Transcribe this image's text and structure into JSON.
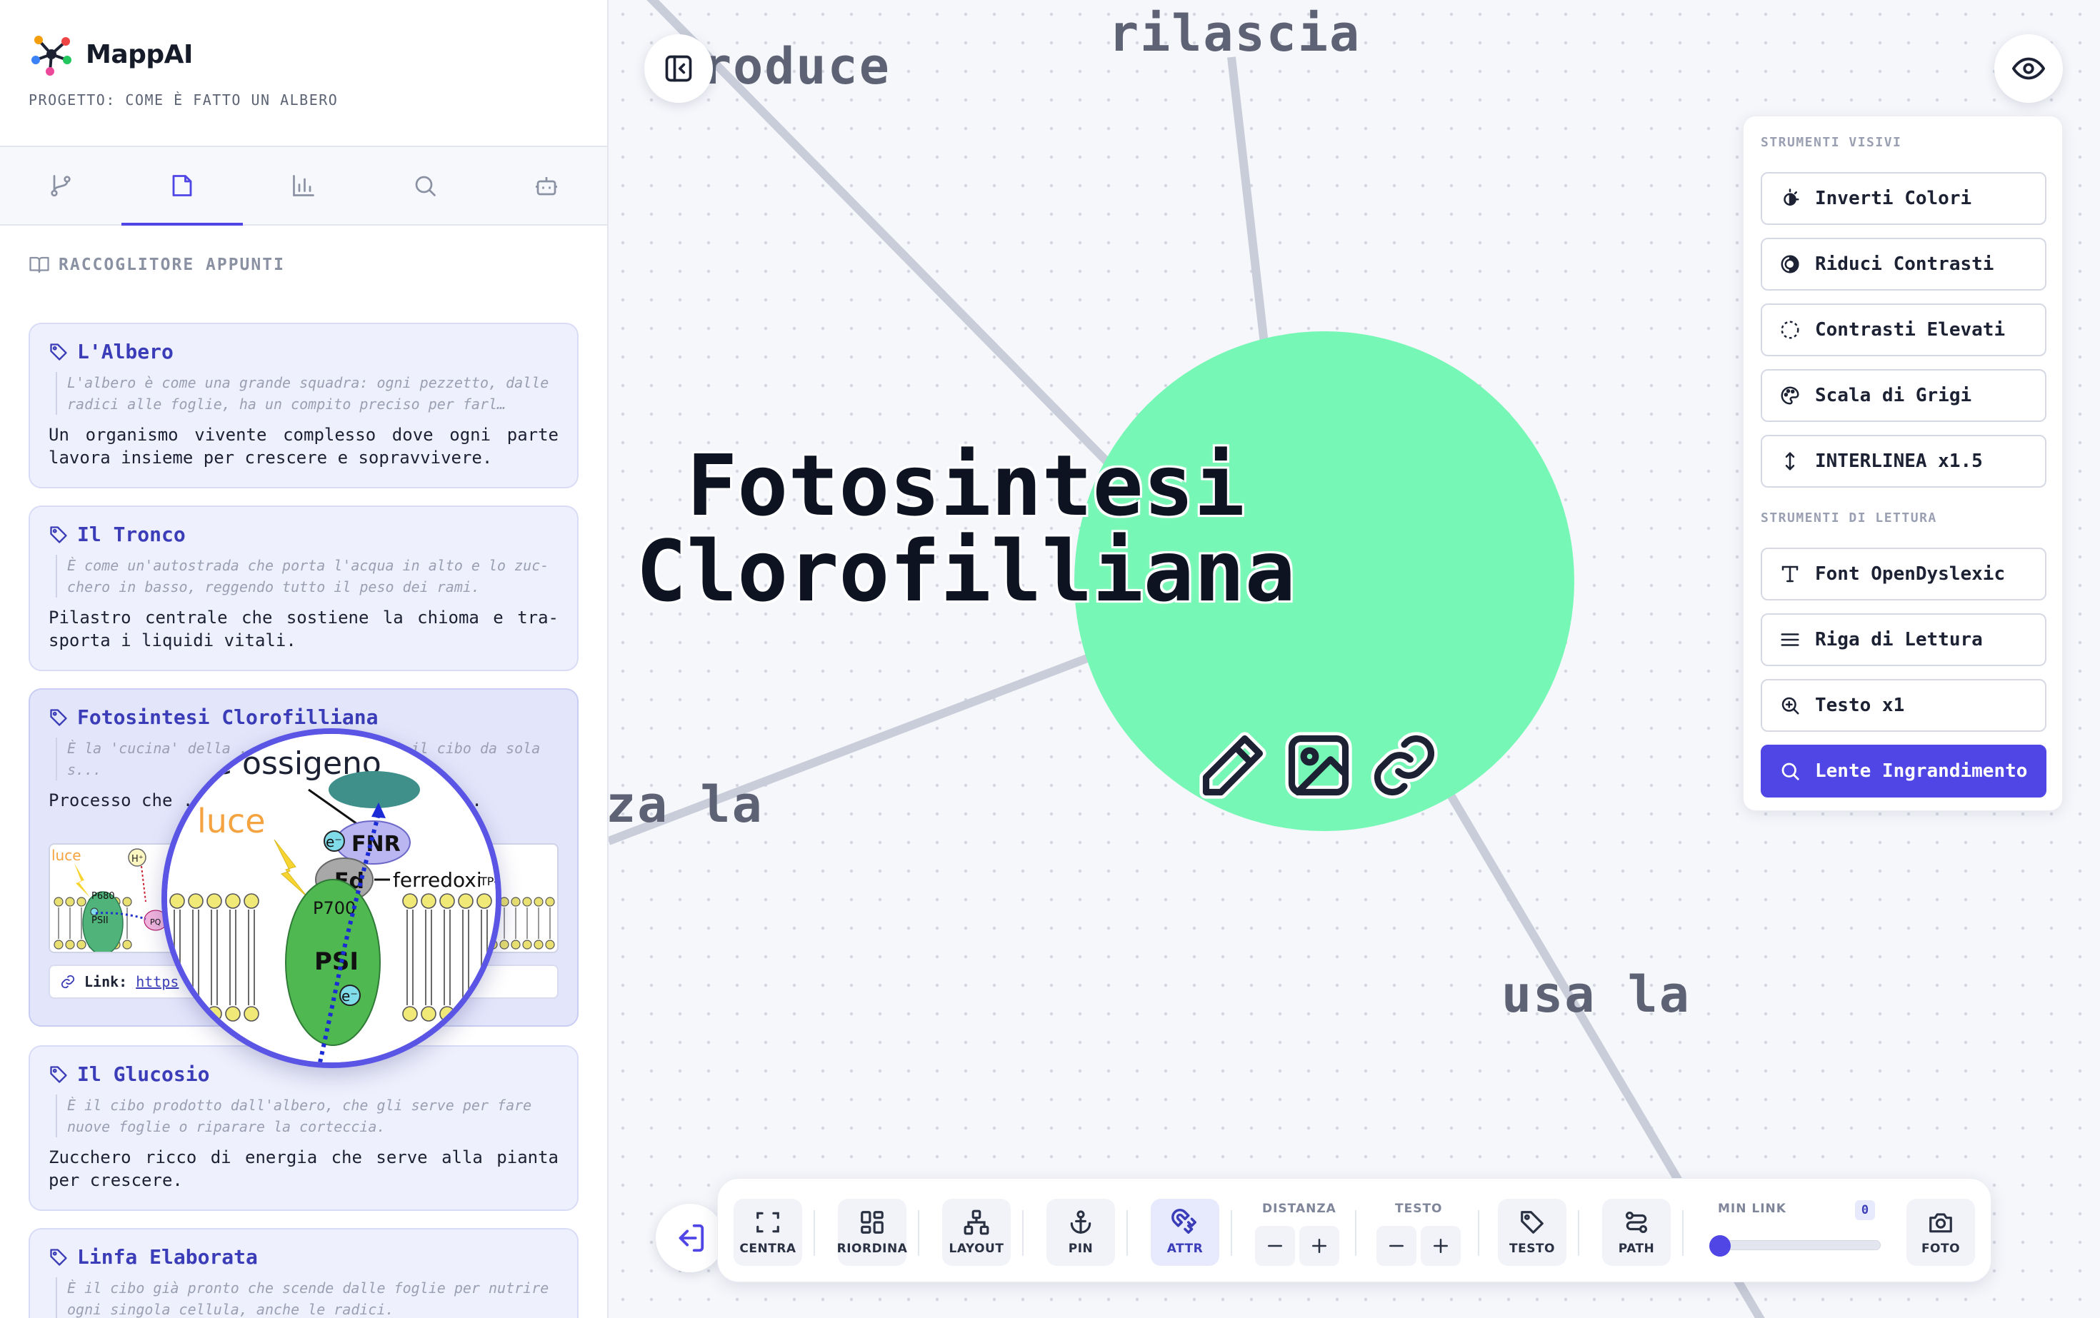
{
  "app": {
    "name": "MappAI",
    "project": "PROGETTO: COME È FATTO UN ALBERO"
  },
  "sidebar": {
    "tabs": [
      {
        "icon": "git-branch-icon"
      },
      {
        "icon": "note-icon",
        "active": true
      },
      {
        "icon": "bar-chart-icon"
      },
      {
        "icon": "search-icon"
      },
      {
        "icon": "bot-icon"
      }
    ],
    "section_title": "RACCOGLITORE APPUNTI",
    "notes": [
      {
        "title": "L'Albero",
        "quote": "L'albero è come una grande squadra: ogni pezzetto, dalle radici alle foglie, ha un compito preciso per farl…",
        "body": "Un organismo vivente complesso dove ogni parte lavora insieme per crescere e sopravvivere."
      },
      {
        "title": "Il Tronco",
        "quote": "È come un'autostrada che porta l'acqua in alto e lo zuc­chero in basso, reggendo tutto il peso dei rami.",
        "body": "Pilastro centrale che sostiene la chioma e tra­sporta i liquidi vitali."
      },
      {
        "title": "Fotosintesi Clorofilliana",
        "quote": "È la 'cucina' della ... per fabbricarsi il cibo da sola s...",
        "body": "Processo che ... anidride carbonica in ...",
        "link_label": "Link:",
        "link_url": "https",
        "image_labels": {
          "luce": "luce",
          "h": "H⁺",
          "p680": "P680",
          "psii": "PSII",
          "pq": "PQ"
        },
        "magnifier": {
          "ossigeno": "e ossigeno",
          "luce": "luce",
          "fnr": "FNR",
          "fd": "Fd",
          "ferredoxina": "ferredoxi",
          "atp": "TP-sintetasi",
          "p700": "P700",
          "psi": "PSI",
          "e": "e⁻"
        }
      },
      {
        "title": "Il Glucosio",
        "quote": "È il cibo prodotto dall'albero, che gli serve per fare nuove foglie o riparare la corteccia.",
        "body": "Zucchero ricco di energia che serve alla pianta per crescere."
      },
      {
        "title": "Linfa Elaborata",
        "quote": "È il cibo già pronto che scende dalle foglie per nutrire ogni singola cellula, anche le radici.",
        "body": ""
      }
    ]
  },
  "canvas": {
    "edge_labels": [
      "roduce",
      "rilascia",
      "za la",
      "usa la"
    ],
    "node": {
      "title_line1": "Fotosintesi",
      "title_line2": "Clorofilliana",
      "color": "#77f7b5"
    },
    "node_tools": [
      "pencil-icon",
      "image-icon",
      "link-icon"
    ]
  },
  "accessibility": {
    "visual_group": "STRUMENTI VISIVI",
    "visual_tools": [
      {
        "label": "Inverti Colori",
        "icon": "invert-icon"
      },
      {
        "label": "Riduci Contrasti",
        "icon": "contrast-icon"
      },
      {
        "label": "Contrasti Elevati",
        "icon": "dashed-circle-icon"
      },
      {
        "label": "Scala di Grigi",
        "icon": "palette-icon"
      },
      {
        "label": "INTERLINEA x1.5",
        "icon": "line-height-icon"
      }
    ],
    "reading_group": "STRUMENTI DI LETTURA",
    "reading_tools": [
      {
        "label": "Font OpenDyslexic",
        "icon": "type-icon"
      },
      {
        "label": "Riga di Lettura",
        "icon": "lines-icon"
      },
      {
        "label": "Testo x1",
        "icon": "zoom-in-icon"
      },
      {
        "label": "Lente Ingrandimento",
        "icon": "search-icon",
        "active": true
      }
    ]
  },
  "toolbar": {
    "centra": "CENTRA",
    "riordina": "RIORDINA",
    "layout": "LAYOUT",
    "pin": "PIN",
    "attr": "ATTR",
    "distanza": "DISTANZA",
    "testo_group": "TESTO",
    "testo": "TESTO",
    "path": "PATH",
    "min_link": "MIN LINK",
    "min_link_value": "0",
    "foto": "FOTO"
  },
  "colors": {
    "accent": "#4f46e5",
    "node": "#77f7b5"
  }
}
